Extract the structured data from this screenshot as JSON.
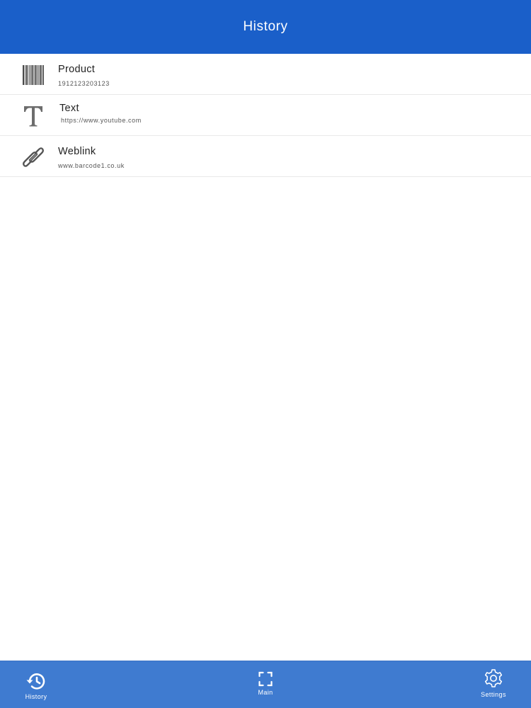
{
  "header": {
    "title": "History"
  },
  "history": {
    "items": [
      {
        "title": "Product",
        "value": "1912123203123",
        "icon": "barcode-icon"
      },
      {
        "title": "Text",
        "value": "https://www.youtube.com",
        "icon": "text-type-icon"
      },
      {
        "title": "Weblink",
        "value": "www.barcode1.co.uk",
        "icon": "link-icon"
      }
    ]
  },
  "tabbar": {
    "history_label": "History",
    "main_label": "Main",
    "settings_label": "Settings"
  },
  "colors": {
    "header": "#1a5fc9",
    "tabbar": "#3f7bd0",
    "icon_gray": "#6d6d6d"
  }
}
